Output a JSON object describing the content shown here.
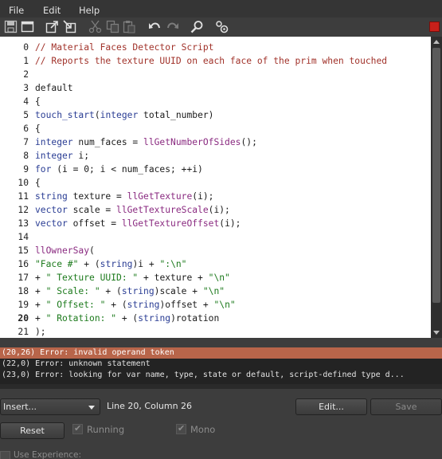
{
  "menubar": {
    "items": [
      "File",
      "Edit",
      "Help"
    ]
  },
  "toolbar": {
    "icons": [
      "save-icon",
      "new-window-icon",
      "export-icon",
      "import-icon",
      "cut-icon",
      "copy-icon",
      "paste-icon",
      "undo-icon",
      "redo-icon",
      "search-icon",
      "settings-icon"
    ],
    "record_color": "#c8201a"
  },
  "editor": {
    "current_line": 20,
    "lines": [
      [
        [
          "c",
          "// Material Faces Detector Script"
        ]
      ],
      [
        [
          "c",
          "// Reports the texture UUID on each face of the prim when touched"
        ]
      ],
      [],
      [
        [
          "p",
          "default"
        ]
      ],
      [
        [
          "p",
          "{"
        ]
      ],
      [
        [
          "e",
          "touch_start"
        ],
        [
          "p",
          "("
        ],
        [
          "t",
          "integer"
        ],
        [
          "p",
          " total_number)"
        ]
      ],
      [
        [
          "p",
          "{"
        ]
      ],
      [
        [
          "t",
          "integer"
        ],
        [
          "p",
          " num_faces = "
        ],
        [
          "f",
          "llGetNumberOfSides"
        ],
        [
          "p",
          "();"
        ]
      ],
      [
        [
          "t",
          "integer"
        ],
        [
          "p",
          " i;"
        ]
      ],
      [
        [
          "t",
          "for"
        ],
        [
          "p",
          " (i = 0; i < num_faces; ++i)"
        ]
      ],
      [
        [
          "p",
          "{"
        ]
      ],
      [
        [
          "t",
          "string"
        ],
        [
          "p",
          " texture = "
        ],
        [
          "f",
          "llGetTexture"
        ],
        [
          "p",
          "(i);"
        ]
      ],
      [
        [
          "t",
          "vector"
        ],
        [
          "p",
          " scale = "
        ],
        [
          "f",
          "llGetTextureScale"
        ],
        [
          "p",
          "(i);"
        ]
      ],
      [
        [
          "t",
          "vector"
        ],
        [
          "p",
          " offset = "
        ],
        [
          "f",
          "llGetTextureOffset"
        ],
        [
          "p",
          "(i);"
        ]
      ],
      [],
      [
        [
          "f",
          "llOwnerSay"
        ],
        [
          "p",
          "("
        ]
      ],
      [
        [
          "s",
          "\"Face #\""
        ],
        [
          "p",
          " + ("
        ],
        [
          "t",
          "string"
        ],
        [
          "p",
          ")i + "
        ],
        [
          "s",
          "\":\\n\""
        ]
      ],
      [
        [
          "p",
          "+ "
        ],
        [
          "s",
          "\" Texture UUID: \""
        ],
        [
          "p",
          " + texture + "
        ],
        [
          "s",
          "\"\\n\""
        ]
      ],
      [
        [
          "p",
          "+ "
        ],
        [
          "s",
          "\" Scale: \""
        ],
        [
          "p",
          " + ("
        ],
        [
          "t",
          "string"
        ],
        [
          "p",
          ")scale + "
        ],
        [
          "s",
          "\"\\n\""
        ]
      ],
      [
        [
          "p",
          "+ "
        ],
        [
          "s",
          "\" Offset: \""
        ],
        [
          "p",
          " + ("
        ],
        [
          "t",
          "string"
        ],
        [
          "p",
          ")offset + "
        ],
        [
          "s",
          "\"\\n\""
        ]
      ],
      [
        [
          "p",
          "+ "
        ],
        [
          "s",
          "\" Rotation: \""
        ],
        [
          "p",
          " + ("
        ],
        [
          "t",
          "string"
        ],
        [
          "p",
          ")rotation"
        ]
      ],
      [
        [
          "p",
          ");"
        ]
      ]
    ]
  },
  "errors": [
    "(20,26) Error: invalid operand token",
    "(22,0) Error: unknown statement",
    "(23,0) Error: looking for var name, type, state or default, script-defined type d..."
  ],
  "errors_selected_index": 0,
  "controls": {
    "insert_label": "Insert...",
    "status": "Line 20, Column 26",
    "edit_label": "Edit...",
    "save_label": "Save",
    "reset_label": "Reset",
    "running_label": "Running",
    "mono_label": "Mono",
    "use_experience_label": "Use Experience:"
  }
}
